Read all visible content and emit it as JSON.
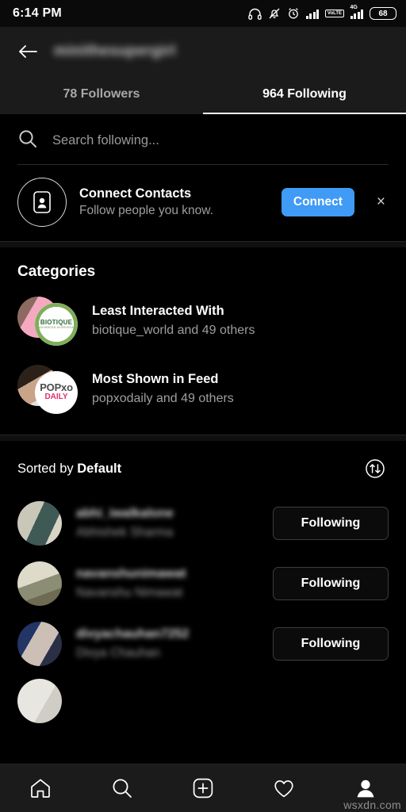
{
  "status_bar": {
    "time": "6:14 PM",
    "battery_level": "68",
    "network_badge": "VoLTE",
    "network_type": "4G",
    "icons": [
      "headphones-icon",
      "bell-muted-icon",
      "alarm-clock-icon",
      "signal-bars-icon",
      "volte-icon",
      "signal-bars-4g-icon",
      "battery-icon"
    ]
  },
  "header": {
    "back_icon": "back-arrow-icon",
    "username": "minithesupergirl",
    "tabs": [
      {
        "label": "78 Followers",
        "active": false
      },
      {
        "label": "964 Following",
        "active": true
      }
    ]
  },
  "search": {
    "icon": "search-icon",
    "placeholder": "Search following...",
    "value": ""
  },
  "connect_contacts": {
    "icon": "contact-card-icon",
    "title": "Connect Contacts",
    "subtitle": "Follow people you know.",
    "button_label": "Connect",
    "button_color": "#3f9bf5",
    "dismiss_label": "×"
  },
  "categories": {
    "heading": "Categories",
    "items": [
      {
        "title": "Least Interacted With",
        "subtitle": "biotique_world and 49 others",
        "avatar_back_color": "#f4a9c0",
        "avatar_front_label": "BIOTIQUE",
        "avatar_front_sublabel": "ADVANCED AYURVEDA"
      },
      {
        "title": "Most Shown in Feed",
        "subtitle": "popxodaily and 49 others",
        "avatar_back_color": "#6d5a4a",
        "avatar_front_label": "POPxo",
        "avatar_front_sublabel": "DAILY"
      }
    ]
  },
  "sort": {
    "prefix": "Sorted by ",
    "value": "Default",
    "icon": "sort-arrows-icon"
  },
  "user_list": {
    "rows": [
      {
        "handle": "abhi_iwalkalone",
        "name": "Abhishek Sharma",
        "button_label": "Following",
        "avatar_color_a": "#c9c7b8",
        "avatar_color_b": "#3f5a55"
      },
      {
        "handle": "navanshunimawat",
        "name": "Navanshu Nimawat",
        "button_label": "Following",
        "avatar_color_a": "#d8d5c4",
        "avatar_color_b": "#7c7560"
      },
      {
        "handle": "divyachauhan7252",
        "name": "Divya Chauhan",
        "button_label": "Following",
        "avatar_color_a": "#2a3e6e",
        "avatar_color_b": "#cfc3bb"
      }
    ]
  },
  "bottom_nav": {
    "items": [
      "home-icon",
      "search-icon",
      "add-post-icon",
      "activity-heart-icon",
      "profile-avatar-icon"
    ]
  },
  "watermark": "wsxdn.com"
}
